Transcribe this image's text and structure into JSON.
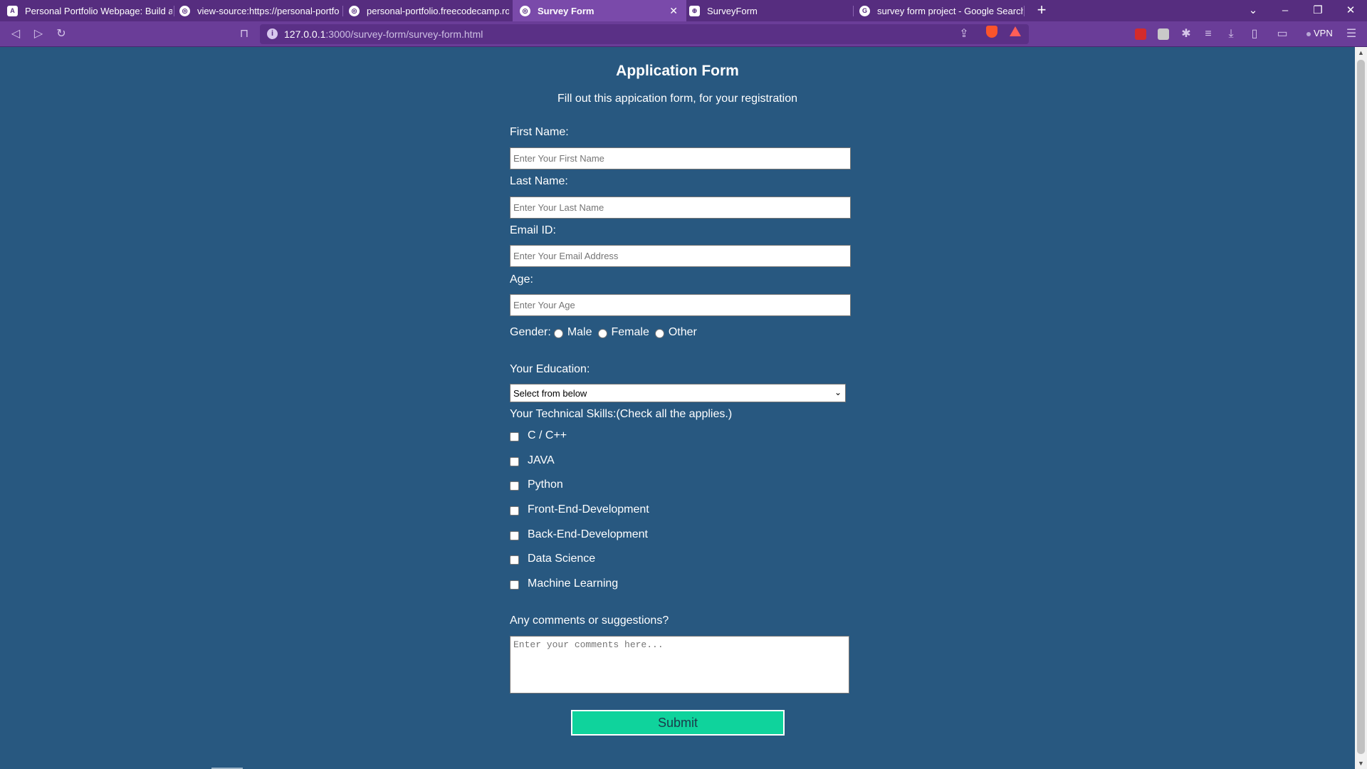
{
  "browser": {
    "tabs": [
      {
        "favicon": "A",
        "title": "Personal Portfolio Webpage: Build a P",
        "active": false
      },
      {
        "favicon": "globe-icon",
        "title": "view-source:https://personal-portfolio",
        "active": false
      },
      {
        "favicon": "globe-icon",
        "title": "personal-portfolio.freecodecamp.rock",
        "active": false
      },
      {
        "favicon": "globe-icon",
        "title": "Survey Form",
        "active": true
      },
      {
        "favicon": "code-icon",
        "title": "SurveyForm",
        "active": false
      },
      {
        "favicon": "G",
        "title": "survey form project - Google Search",
        "active": false
      }
    ],
    "tab_close": "✕",
    "new_tab": "+",
    "url_host": "127.0.0.1",
    "url_rest": ":3000/survey-form/survey-form.html",
    "vpn": "VPN"
  },
  "form": {
    "title": "Application Form",
    "subtitle": "Fill out this appication form, for your registration",
    "first_name": {
      "label": "First Name:",
      "placeholder": "Enter Your First Name"
    },
    "last_name": {
      "label": "Last Name:",
      "placeholder": "Enter Your Last Name"
    },
    "email": {
      "label": "Email ID:",
      "placeholder": "Enter Your Email Address"
    },
    "age": {
      "label": "Age:",
      "placeholder": "Enter Your Age"
    },
    "gender": {
      "label": "Gender:",
      "options": [
        "Male",
        "Female",
        "Other"
      ]
    },
    "education": {
      "label": "Your Education:",
      "selected": "Select from below"
    },
    "skills": {
      "label": "Your Technical Skills:(Check all the applies.)",
      "options": [
        "C / C++",
        "JAVA",
        "Python",
        "Front-End-Development",
        "Back-End-Development",
        "Data Science",
        "Machine Learning"
      ]
    },
    "comments": {
      "label": "Any comments or suggestions?",
      "placeholder": "Enter your comments here..."
    },
    "submit": "Submit"
  },
  "colors": {
    "page_bg": "#285880",
    "tabbar_bg": "#562d7f",
    "toolbar_bg": "#6a3d98",
    "submit_bg": "#0fd39c"
  }
}
